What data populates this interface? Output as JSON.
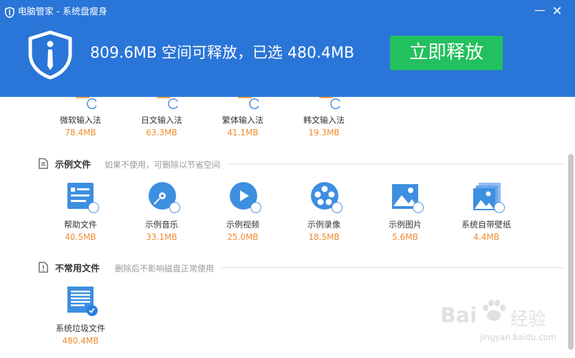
{
  "window": {
    "title": "电脑管家 - 系统盘瘦身",
    "minimize_label": "—",
    "close_label": "✕"
  },
  "header": {
    "summary": "809.6MB 空间可释放，已选 480.4MB",
    "release_button": "立即释放"
  },
  "input_methods": [
    {
      "name": "微软输入法",
      "size": "78.4MB",
      "checked": false
    },
    {
      "name": "日文输入法",
      "size": "63.3MB",
      "checked": false
    },
    {
      "name": "繁体输入法",
      "size": "41.1MB",
      "checked": false
    },
    {
      "name": "韩文输入法",
      "size": "19.3MB",
      "checked": false
    }
  ],
  "sample_files": {
    "title": "示例文件",
    "description": "如果不使用，可删除以节省空间",
    "items": [
      {
        "name": "帮助文件",
        "size": "40.5MB",
        "icon": "help-doc-icon",
        "checked": false
      },
      {
        "name": "示例音乐",
        "size": "33.1MB",
        "icon": "music-disc-icon",
        "checked": false
      },
      {
        "name": "示例视频",
        "size": "25.0MB",
        "icon": "play-icon",
        "checked": false
      },
      {
        "name": "示例录像",
        "size": "18.5MB",
        "icon": "film-reel-icon",
        "checked": false
      },
      {
        "name": "示例图片",
        "size": "5.6MB",
        "icon": "picture-icon",
        "checked": false
      },
      {
        "name": "系统自带壁纸",
        "size": "4.4MB",
        "icon": "wallpaper-icon",
        "checked": false
      }
    ]
  },
  "unused_files": {
    "title": "不常用文件",
    "description": "删除后不影响磁盘正常使用",
    "items": [
      {
        "name": "系统垃圾文件",
        "size": "480.4MB",
        "icon": "junk-file-icon",
        "checked": true
      }
    ]
  },
  "watermark": {
    "brand": "Bai",
    "brand_suffix": "经验",
    "url": "jingyan.baidu.com"
  },
  "colors": {
    "header_blue": "#2a75d8",
    "release_green": "#22c05e",
    "size_orange": "#f08a2d",
    "icon_blue": "#3d8fe0"
  }
}
